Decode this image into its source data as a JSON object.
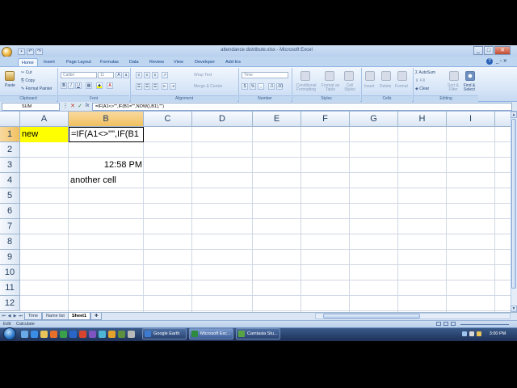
{
  "window": {
    "title": "attendance distribute.xlsx - Microsoft Excel",
    "buttons": {
      "minimize": "_",
      "maximize": "□",
      "close": "✕"
    }
  },
  "ribbon": {
    "tabs": [
      "Home",
      "Insert",
      "Page Layout",
      "Formulas",
      "Data",
      "Review",
      "View",
      "Developer",
      "Add-Ins"
    ],
    "active_tab": "Home",
    "clipboard": {
      "paste": "Paste",
      "cut": "Cut",
      "copy": "Copy",
      "format_painter": "Format Painter",
      "label": "Clipboard"
    },
    "font": {
      "name": "Calibri",
      "size": "11",
      "label": "Font"
    },
    "alignment": {
      "wrap_text": "Wrap Text",
      "merge_center": "Merge & Center",
      "label": "Alignment"
    },
    "number": {
      "format": "Time",
      "label": "Number"
    },
    "styles": {
      "conditional": "Conditional Formatting",
      "format_table": "Format as Table",
      "cell_styles": "Cell Styles",
      "label": "Styles"
    },
    "cells": {
      "insert": "Insert",
      "delete": "Delete",
      "format": "Format",
      "label": "Cells"
    },
    "editing": {
      "autosum": "AutoSum",
      "fill": "Fill",
      "clear": "Clear",
      "sort_filter": "Sort & Filter",
      "find_select": "Find & Select",
      "label": "Editing"
    }
  },
  "formula_bar": {
    "name_box": "SUM",
    "fx": "fx",
    "cancel": "✕",
    "enter": "✓",
    "formula": "=IF(A1<>\"\",IF(B1=\"\",NOW(),B1),\"\")"
  },
  "sheet": {
    "columns": [
      "A",
      "B",
      "C",
      "D",
      "E",
      "F",
      "G",
      "H",
      "I"
    ],
    "rows": [
      "1",
      "2",
      "3",
      "4",
      "5",
      "6",
      "7",
      "8",
      "9",
      "10",
      "11",
      "12"
    ],
    "cells": {
      "A1": "new",
      "B1": "=IF(A1<>\"\",IF(B1",
      "B3": "12:58 PM",
      "B4": "another cell"
    },
    "highlight_color": "#ffff00"
  },
  "sheet_tabs": [
    "Time",
    "Name list",
    "Sheet1"
  ],
  "active_sheet": "Sheet1",
  "status": {
    "mode": "Edit",
    "calculate": "Calculate"
  },
  "taskbar": {
    "items": [
      "Google Earth",
      "Microsoft Exc...",
      "Camtasia Stu..."
    ],
    "active_item": "Microsoft Exc...",
    "clock": "3:00 PM"
  }
}
